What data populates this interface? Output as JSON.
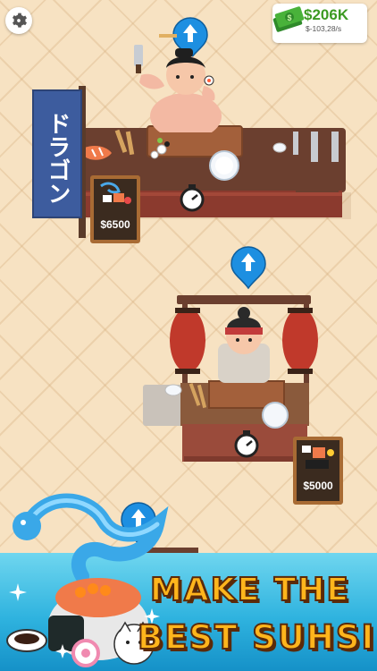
{
  "hud": {
    "money": "$206K",
    "income_rate": "$-103,28/s"
  },
  "shop": {
    "banner_text": "ドラゴン",
    "sign_top_price": "$6500",
    "sign_mid_price": "$5000"
  },
  "promo": {
    "line1": "MAKE THE",
    "line2": "BEST SUHSI"
  },
  "colors": {
    "floor": "#f7e2c2",
    "counter": "#6b3f2f",
    "money_green": "#3c9a22",
    "bubble_blue": "#1d8fe1",
    "promo_orange": "#ffb51c"
  }
}
